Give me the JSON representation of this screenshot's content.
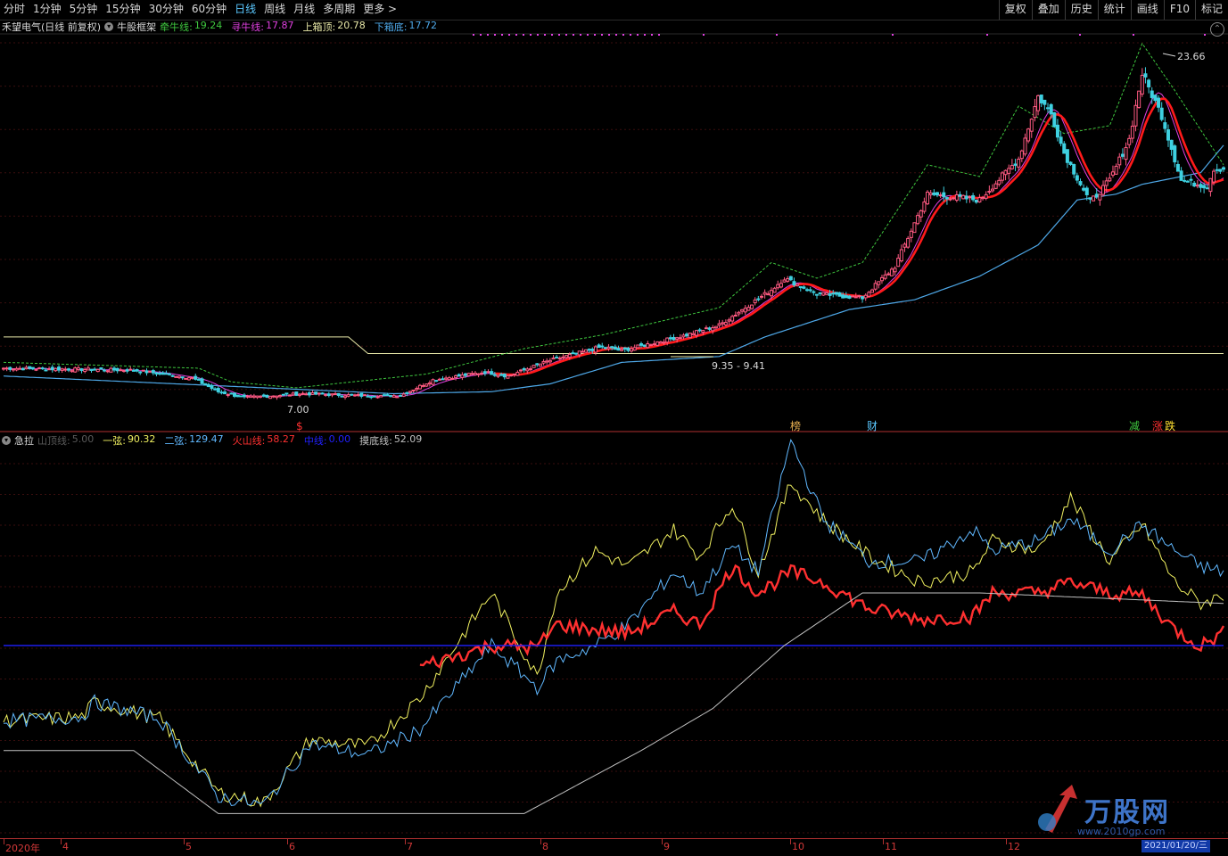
{
  "toolbar": {
    "periods": [
      {
        "label": "分时"
      },
      {
        "label": "1分钟"
      },
      {
        "label": "5分钟"
      },
      {
        "label": "15分钟"
      },
      {
        "label": "30分钟"
      },
      {
        "label": "60分钟"
      },
      {
        "label": "日线"
      },
      {
        "label": "周线"
      },
      {
        "label": "月线"
      },
      {
        "label": "多周期"
      },
      {
        "label": "更多 >"
      }
    ],
    "active_period": "日线",
    "tools": [
      {
        "label": "复权"
      },
      {
        "label": "叠加"
      },
      {
        "label": "历史"
      },
      {
        "label": "统计"
      },
      {
        "label": "画线"
      },
      {
        "label": "F10"
      },
      {
        "label": "标记"
      }
    ]
  },
  "main_legend": {
    "stock": "禾望电气(日线 前复权)",
    "indicator_name": "牛股框架",
    "items": [
      {
        "label": "牵牛线:",
        "value": "19.24",
        "color": "#3fc73f"
      },
      {
        "label": "寻牛线:",
        "value": "17.87",
        "color": "#e040e0"
      },
      {
        "label": "上箱顶:",
        "value": "20.78",
        "color": "#e8e8a8"
      },
      {
        "label": "下箱底:",
        "value": "17.72",
        "color": "#4ea8e8"
      }
    ]
  },
  "sub_legend": {
    "indicator_name": "急拉",
    "items": [
      {
        "label": "山顶线:",
        "value": "5.00",
        "color": "#5a5a5a"
      },
      {
        "label": "一弦:",
        "value": "90.32",
        "color": "#f0f060"
      },
      {
        "label": "二弦:",
        "value": "129.47",
        "color": "#60b8ff"
      },
      {
        "label": "火山线:",
        "value": "58.27",
        "color": "#ff3030"
      },
      {
        "label": "中线:",
        "value": "0.00",
        "color": "#2020ff"
      },
      {
        "label": "摸底线:",
        "value": "52.09",
        "color": "#c0c0c0"
      }
    ]
  },
  "annotations": {
    "high": "23.66",
    "low": "7.00",
    "range": "9.35 - 9.41"
  },
  "markers": [
    {
      "label": "$",
      "color": "#ff3030"
    },
    {
      "label": "榜",
      "color": "#e8b050"
    },
    {
      "label": "财",
      "color": "#5bc8ff"
    },
    {
      "label": "减",
      "color": "#3fc73f"
    },
    {
      "label": "涨",
      "color": "#ff3030"
    },
    {
      "label": "跌",
      "color": "#ffe030"
    }
  ],
  "x_axis": [
    "2020年",
    "4",
    "5",
    "6",
    "7",
    "8",
    "9",
    "10",
    "11",
    "12"
  ],
  "cursor_date": "2021/01/20/三",
  "watermark": {
    "name": "万股网",
    "url": "www.2010gp.com"
  },
  "chart_data": [
    {
      "type": "candlestick",
      "series": [
        {
          "name": "牵牛线",
          "role": "support_red",
          "color": "#ff1a1a"
        },
        {
          "name": "寻牛线",
          "color": "#e040e0"
        },
        {
          "name": "上箱顶",
          "color": "#e8e8a8"
        },
        {
          "name": "下箱底",
          "color": "#4ea8e8"
        }
      ],
      "colors": {
        "up": "#ff5a82",
        "down": "#3ed0e0",
        "upper_band": "#3fc73f"
      },
      "ylim": [
        6,
        25.6
      ],
      "price_knots": [
        [
          0,
          8.6
        ],
        [
          40,
          8.5
        ],
        [
          58,
          8.1
        ],
        [
          66,
          7.4
        ],
        [
          74,
          7.1
        ],
        [
          92,
          7.3
        ],
        [
          110,
          7.2
        ],
        [
          122,
          7.2
        ],
        [
          132,
          8.0
        ],
        [
          148,
          8.4
        ],
        [
          155,
          8.2
        ],
        [
          168,
          9.0
        ],
        [
          184,
          9.7
        ],
        [
          190,
          9.5
        ],
        [
          210,
          10.3
        ],
        [
          220,
          10.8
        ],
        [
          236,
          12.6
        ],
        [
          240,
          13.2
        ],
        [
          250,
          12.4
        ],
        [
          264,
          12.2
        ],
        [
          274,
          13.8
        ],
        [
          284,
          17.5
        ],
        [
          300,
          17.2
        ],
        [
          312,
          19.3
        ],
        [
          318,
          22.5
        ],
        [
          322,
          21.6
        ],
        [
          326,
          19.6
        ],
        [
          334,
          17.1
        ],
        [
          340,
          18.2
        ],
        [
          346,
          20.3
        ],
        [
          350,
          23.66
        ],
        [
          356,
          21.5
        ],
        [
          362,
          18.2
        ],
        [
          370,
          17.9
        ],
        [
          372,
          18.8
        ]
      ],
      "box_top_knots": [
        [
          0,
          10.2
        ],
        [
          106,
          10.2
        ],
        [
          112,
          9.35
        ],
        [
          160,
          9.35
        ],
        [
          170,
          9.35
        ],
        [
          240,
          9.35
        ],
        [
          375,
          9.35
        ]
      ],
      "box_bottom_knots": [
        [
          0,
          8.2
        ],
        [
          120,
          7.3
        ],
        [
          150,
          7.4
        ],
        [
          168,
          7.8
        ],
        [
          190,
          8.9
        ],
        [
          220,
          9.2
        ],
        [
          234,
          10.2
        ],
        [
          260,
          11.6
        ],
        [
          280,
          12.1
        ],
        [
          300,
          13.3
        ],
        [
          318,
          14.9
        ],
        [
          330,
          17.2
        ],
        [
          342,
          17.5
        ],
        [
          350,
          18.0
        ],
        [
          368,
          18.6
        ],
        [
          375,
          20.0
        ]
      ],
      "upper_band_knots": [
        [
          0,
          8.9
        ],
        [
          60,
          8.6
        ],
        [
          70,
          7.9
        ],
        [
          90,
          7.6
        ],
        [
          130,
          8.3
        ],
        [
          160,
          9.6
        ],
        [
          184,
          10.3
        ],
        [
          220,
          11.7
        ],
        [
          236,
          14.0
        ],
        [
          250,
          13.2
        ],
        [
          264,
          14.0
        ],
        [
          284,
          19.0
        ],
        [
          300,
          18.4
        ],
        [
          312,
          22.0
        ],
        [
          326,
          20.6
        ],
        [
          340,
          21.0
        ],
        [
          350,
          25.2
        ],
        [
          360,
          22.8
        ],
        [
          375,
          19.0
        ]
      ]
    },
    {
      "type": "line",
      "ylim": [
        -120,
        250
      ],
      "series": [
        {
          "name": "一弦",
          "color": "#f0f060",
          "knots": [
            [
              0,
              -12
            ],
            [
              24,
              -8
            ],
            [
              28,
              6
            ],
            [
              48,
              -10
            ],
            [
              66,
              -80
            ],
            [
              80,
              -90
            ],
            [
              94,
              -30
            ],
            [
              112,
              -36
            ],
            [
              128,
              10
            ],
            [
              150,
              110
            ],
            [
              164,
              30
            ],
            [
              170,
              110
            ],
            [
              182,
              150
            ],
            [
              192,
              135
            ],
            [
              206,
              170
            ],
            [
              214,
              145
            ],
            [
              224,
              195
            ],
            [
              232,
              130
            ],
            [
              242,
              215
            ],
            [
              252,
              180
            ],
            [
              266,
              145
            ],
            [
              282,
              120
            ],
            [
              298,
              130
            ],
            [
              304,
              160
            ],
            [
              318,
              150
            ],
            [
              328,
              200
            ],
            [
              340,
              140
            ],
            [
              350,
              175
            ],
            [
              360,
              120
            ],
            [
              368,
              100
            ],
            [
              375,
              108
            ]
          ]
        },
        {
          "name": "二弦",
          "color": "#60b8ff",
          "knots": [
            [
              0,
              -12
            ],
            [
              24,
              -8
            ],
            [
              28,
              6
            ],
            [
              48,
              -10
            ],
            [
              66,
              -84
            ],
            [
              80,
              -92
            ],
            [
              94,
              -34
            ],
            [
              112,
              -44
            ],
            [
              128,
              -20
            ],
            [
              150,
              60
            ],
            [
              164,
              20
            ],
            [
              170,
              45
            ],
            [
              182,
              60
            ],
            [
              192,
              80
            ],
            [
              206,
              130
            ],
            [
              214,
              110
            ],
            [
              224,
              155
            ],
            [
              232,
              130
            ],
            [
              242,
              255
            ],
            [
              252,
              180
            ],
            [
              266,
              140
            ],
            [
              282,
              140
            ],
            [
              298,
              170
            ],
            [
              304,
              150
            ],
            [
              318,
              160
            ],
            [
              328,
              180
            ],
            [
              340,
              150
            ],
            [
              350,
              175
            ],
            [
              360,
              150
            ],
            [
              368,
              135
            ],
            [
              375,
              130
            ]
          ]
        },
        {
          "name": "火山线",
          "color": "#ff3030",
          "knots": [
            [
              128,
              40
            ],
            [
              150,
              60
            ],
            [
              164,
              58
            ],
            [
              170,
              80
            ],
            [
              182,
              75
            ],
            [
              192,
              72
            ],
            [
              206,
              92
            ],
            [
              214,
              80
            ],
            [
              224,
              135
            ],
            [
              232,
              110
            ],
            [
              242,
              130
            ],
            [
              252,
              120
            ],
            [
              266,
              95
            ],
            [
              282,
              85
            ],
            [
              298,
              88
            ],
            [
              304,
              110
            ],
            [
              318,
              110
            ],
            [
              328,
              120
            ],
            [
              340,
              110
            ],
            [
              350,
              108
            ],
            [
              360,
              75
            ],
            [
              368,
              60
            ],
            [
              375,
              72
            ]
          ]
        },
        {
          "name": "中线",
          "color": "#2020ff",
          "knots": [
            [
              0,
              60
            ],
            [
              375,
              60
            ]
          ]
        },
        {
          "name": "摸底线",
          "color": "#c0c0c0",
          "knots": [
            [
              0,
              -40
            ],
            [
              40,
              -40
            ],
            [
              66,
              -100
            ],
            [
              160,
              -100
            ],
            [
              196,
              -40
            ],
            [
              218,
              0
            ],
            [
              240,
              60
            ],
            [
              264,
              110
            ],
            [
              300,
              110
            ],
            [
              375,
              100
            ]
          ]
        }
      ]
    }
  ]
}
